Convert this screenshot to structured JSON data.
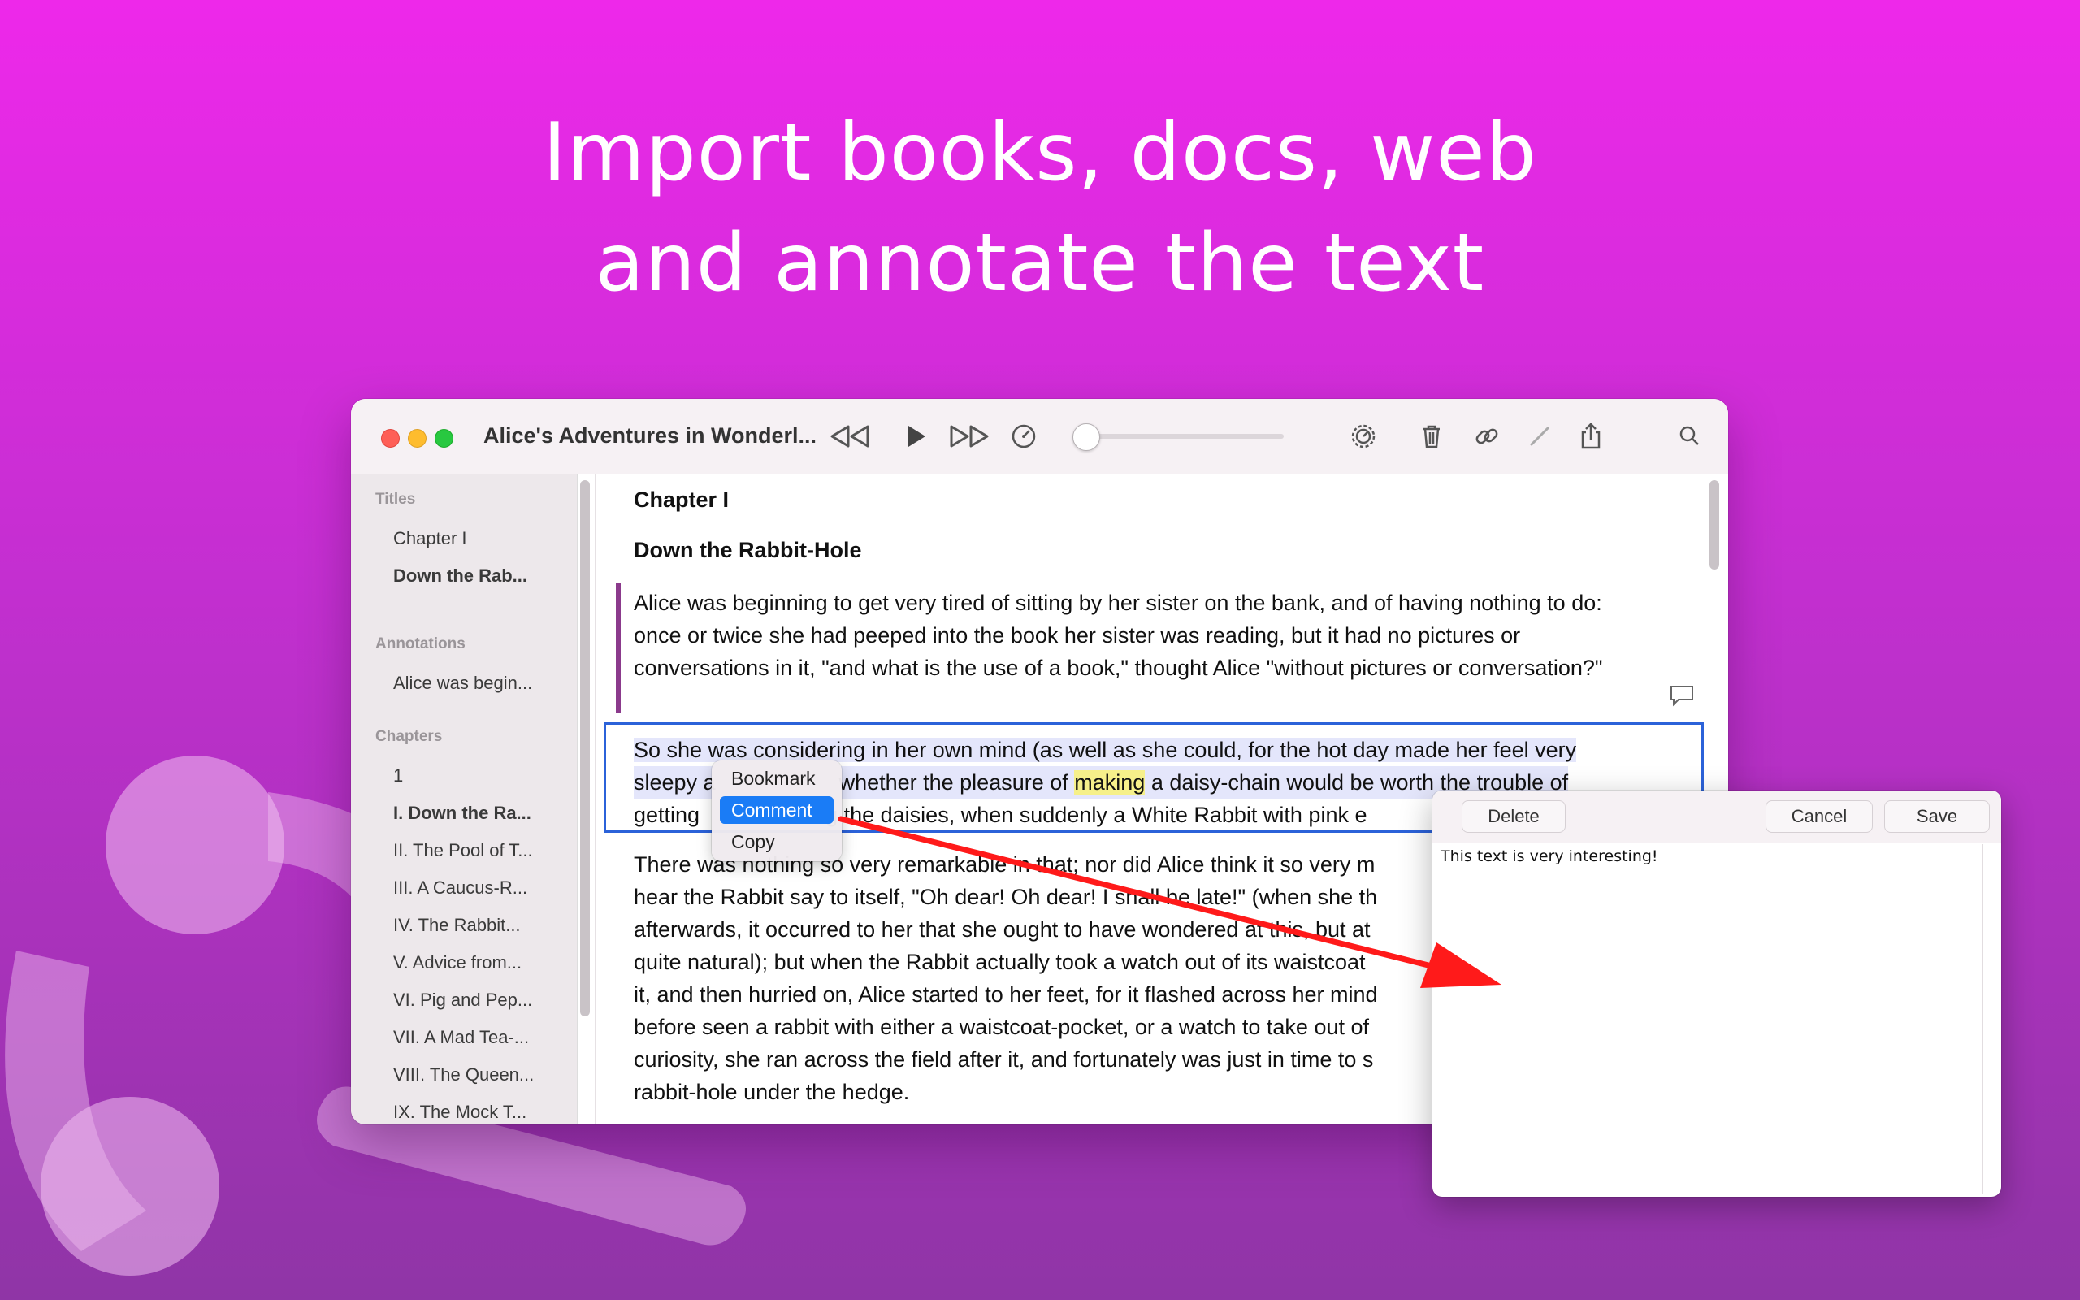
{
  "headline": {
    "line1": "Import books, docs, web",
    "line2": "and annotate the text"
  },
  "window": {
    "title": "Alice's Adventures in Wonderl...",
    "toolbar_icons": [
      "rewind-icon",
      "play-icon",
      "fast-forward-icon",
      "speedometer-icon",
      "settings-icon",
      "trash-icon",
      "link-icon",
      "pencil-icon",
      "share-icon",
      "search-icon"
    ],
    "speed_slider_level": 0.0
  },
  "sidebar": {
    "titles_header": "Titles",
    "titles": [
      "Chapter I",
      "Down the Rab..."
    ],
    "annotations_header": "Annotations",
    "annotations": [
      "Alice was begin..."
    ],
    "chapters_header": "Chapters",
    "chapters": [
      "1",
      "I. Down the Ra...",
      "II. The Pool of T...",
      "III. A Caucus-R...",
      "IV. The Rabbit...",
      "V. Advice from...",
      "VI. Pig and Pep...",
      "VII. A Mad Tea-...",
      "VIII. The Queen...",
      "IX. The Mock T..."
    ]
  },
  "content": {
    "chapter_title": "Chapter I",
    "chapter_subtitle": "Down the Rabbit-Hole",
    "para1": "Alice was beginning to get very tired of sitting by her sister on the bank, and of having nothing to do: once or twice she had peeped into the book her sister was reading, but it had no pictures or conversations in it, \"and what is the use of a book,\" thought Alice \"without pictures or conversation?\"",
    "para2_line1": "So she was considering in her own mind (as well as she could, for the hot day made her feel very",
    "para2_line2_a": "sleepy a",
    "para2_line2_b": "whether the pleasure of",
    "para2_highlight": "making",
    "para2_line2_c": "a daisy-chain would be worth the trouble of",
    "para2_line3_a": "getting",
    "para2_line3_b": "ng the daisies, when suddenly a White Rabbit with pink e",
    "para3_lines": [
      "There was nothing so very remarkable in that; nor did Alice think it so very m",
      "hear the Rabbit say to itself, \"Oh dear! Oh dear! I shall be late!\" (when she th",
      "afterwards, it occurred to her that she ought to have wondered at this, but at",
      "quite natural); but when the Rabbit actually took a watch out of its waistcoat",
      "it, and then hurried on, Alice started to her feet, for it flashed across her mind",
      "before seen a rabbit with either a waistcoat-pocket, or a watch to take out of",
      "curiosity, she ran across the field after it, and fortunately was just in time to s",
      "rabbit-hole under the hedge."
    ]
  },
  "context_menu": {
    "items": [
      "Bookmark",
      "Comment",
      "Copy"
    ],
    "selected": "Comment"
  },
  "comment_popover": {
    "delete_label": "Delete",
    "cancel_label": "Cancel",
    "save_label": "Save",
    "text": "This text is very interesting!"
  },
  "colors": {
    "accent_blue": "#1a7cf6",
    "selection_border": "#2b62d9",
    "annotation_bar": "#8b3a8c",
    "highlight_yellow": "#f6f08a",
    "arrow_red": "#ff1a1a"
  }
}
